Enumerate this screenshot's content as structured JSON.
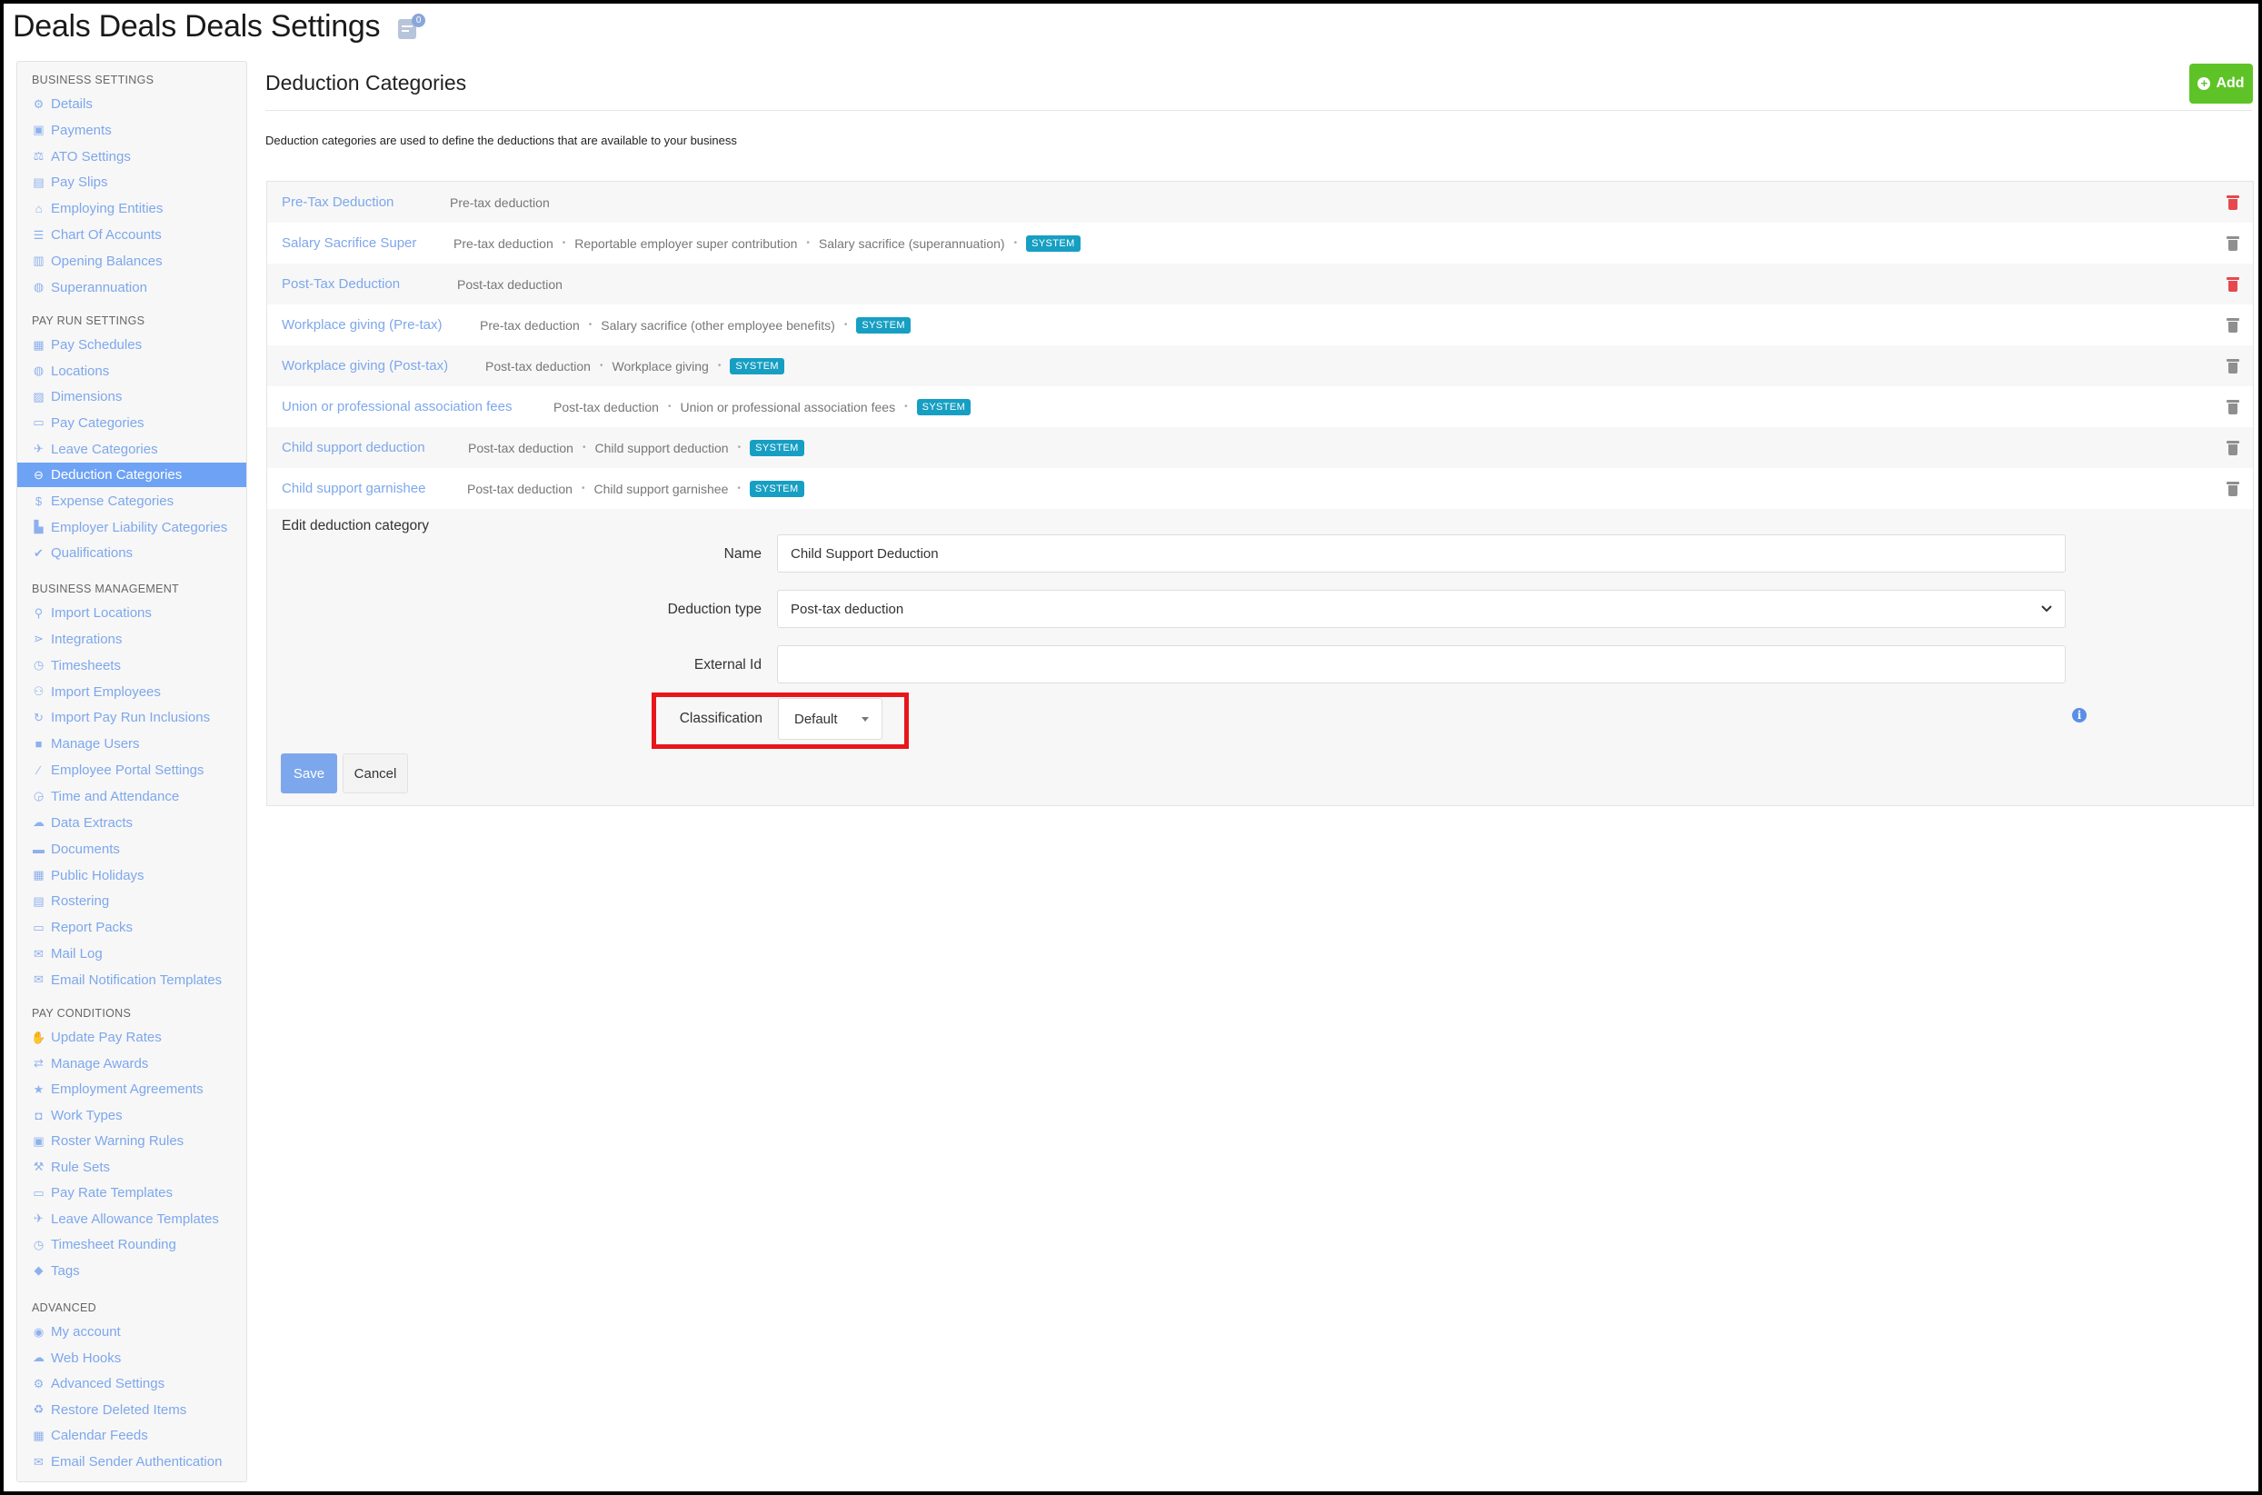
{
  "page": {
    "title": "Deals Deals Deals Settings",
    "notification_count": "0"
  },
  "sidebar": {
    "sections": [
      {
        "title": "BUSINESS SETTINGS",
        "items": [
          {
            "label": "Details",
            "icon": "gear-icon"
          },
          {
            "label": "Payments",
            "icon": "save-icon"
          },
          {
            "label": "ATO Settings",
            "icon": "scale-icon"
          },
          {
            "label": "Pay Slips",
            "icon": "file-icon"
          },
          {
            "label": "Employing Entities",
            "icon": "bank-icon"
          },
          {
            "label": "Chart Of Accounts",
            "icon": "list-icon"
          },
          {
            "label": "Opening Balances",
            "icon": "ledger-icon"
          },
          {
            "label": "Superannuation",
            "icon": "globe-icon"
          }
        ]
      },
      {
        "title": "PAY RUN SETTINGS",
        "items": [
          {
            "label": "Pay Schedules",
            "icon": "calendar-icon"
          },
          {
            "label": "Locations",
            "icon": "globe-icon"
          },
          {
            "label": "Dimensions",
            "icon": "bar-chart-icon"
          },
          {
            "label": "Pay Categories",
            "icon": "money-icon"
          },
          {
            "label": "Leave Categories",
            "icon": "plane-icon"
          },
          {
            "label": "Deduction Categories",
            "icon": "minus-circle-icon",
            "active": true
          },
          {
            "label": "Expense Categories",
            "icon": "dollar-icon"
          },
          {
            "label": "Employer Liability Categories",
            "icon": "factory-icon"
          },
          {
            "label": "Qualifications",
            "icon": "check-icon"
          }
        ]
      },
      {
        "title": "BUSINESS MANAGEMENT",
        "items": [
          {
            "label": "Import Locations",
            "icon": "map-pin-icon"
          },
          {
            "label": "Integrations",
            "icon": "plug-icon"
          },
          {
            "label": "Timesheets",
            "icon": "clock-icon"
          },
          {
            "label": "Import Employees",
            "icon": "people-icon"
          },
          {
            "label": "Import Pay Run Inclusions",
            "icon": "refresh-icon"
          },
          {
            "label": "Manage Users",
            "icon": "lock-icon"
          },
          {
            "label": "Employee Portal Settings",
            "icon": "wand-icon"
          },
          {
            "label": "Time and Attendance",
            "icon": "user-clock-icon"
          },
          {
            "label": "Data Extracts",
            "icon": "cloud-download-icon"
          },
          {
            "label": "Documents",
            "icon": "folder-icon"
          },
          {
            "label": "Public Holidays",
            "icon": "calendar-icon"
          },
          {
            "label": "Rostering",
            "icon": "schedule-icon"
          },
          {
            "label": "Report Packs",
            "icon": "folder-open-icon"
          },
          {
            "label": "Mail Log",
            "icon": "envelope-icon"
          },
          {
            "label": "Email Notification Templates",
            "icon": "envelope-open-icon"
          }
        ]
      },
      {
        "title": "PAY CONDITIONS",
        "items": [
          {
            "label": "Update Pay Rates",
            "icon": "hand-money-icon"
          },
          {
            "label": "Manage Awards",
            "icon": "exchange-icon"
          },
          {
            "label": "Employment Agreements",
            "icon": "star-icon"
          },
          {
            "label": "Work Types",
            "icon": "camera-icon"
          },
          {
            "label": "Roster Warning Rules",
            "icon": "warning-calendar-icon"
          },
          {
            "label": "Rule Sets",
            "icon": "gavel-icon"
          },
          {
            "label": "Pay Rate Templates",
            "icon": "money-icon"
          },
          {
            "label": "Leave Allowance Templates",
            "icon": "plane-icon"
          },
          {
            "label": "Timesheet Rounding",
            "icon": "clock-icon"
          },
          {
            "label": "Tags",
            "icon": "tag-icon"
          }
        ]
      },
      {
        "title": "ADVANCED",
        "items": [
          {
            "label": "My account",
            "icon": "user-circle-icon"
          },
          {
            "label": "Web Hooks",
            "icon": "cloud-icon"
          },
          {
            "label": "Advanced Settings",
            "icon": "gear-icon"
          },
          {
            "label": "Restore Deleted Items",
            "icon": "recycle-icon"
          },
          {
            "label": "Calendar Feeds",
            "icon": "calendar-icon"
          },
          {
            "label": "Email Sender Authentication",
            "icon": "envelope-icon"
          }
        ]
      }
    ]
  },
  "main": {
    "title": "Deduction Categories",
    "add_label": "Add",
    "description": "Deduction categories are used to define the deductions that are available to your business"
  },
  "categories": [
    {
      "name": "Pre-Tax Deduction",
      "tags": [
        "Pre-tax deduction"
      ],
      "system": false,
      "delete_color": "red"
    },
    {
      "name": "Salary Sacrifice Super",
      "tags": [
        "Pre-tax deduction",
        "Reportable employer super contribution",
        "Salary sacrifice (superannuation)"
      ],
      "system": true,
      "delete_color": "grey"
    },
    {
      "name": "Post-Tax Deduction",
      "tags": [
        "Post-tax deduction"
      ],
      "system": false,
      "delete_color": "red"
    },
    {
      "name": "Workplace giving (Pre-tax)",
      "tags": [
        "Pre-tax deduction",
        "Salary sacrifice (other employee benefits)"
      ],
      "system": true,
      "delete_color": "grey"
    },
    {
      "name": "Workplace giving (Post-tax)",
      "tags": [
        "Post-tax deduction",
        "Workplace giving"
      ],
      "system": true,
      "delete_color": "grey"
    },
    {
      "name": "Union or professional association fees",
      "tags": [
        "Post-tax deduction",
        "Union or professional association fees"
      ],
      "system": true,
      "delete_color": "grey"
    },
    {
      "name": "Child support deduction",
      "tags": [
        "Post-tax deduction",
        "Child support deduction"
      ],
      "system": true,
      "delete_color": "grey"
    },
    {
      "name": "Child support garnishee",
      "tags": [
        "Post-tax deduction",
        "Child support garnishee"
      ],
      "system": true,
      "delete_color": "grey"
    }
  ],
  "system_badge": "SYSTEM",
  "edit": {
    "heading": "Edit deduction category",
    "name_label": "Name",
    "name_value": "Child Support Deduction",
    "type_label": "Deduction type",
    "type_value": "Post-tax deduction",
    "external_id_label": "External Id",
    "external_id_value": "",
    "classification_label": "Classification",
    "classification_value": "Default",
    "save_label": "Save",
    "cancel_label": "Cancel"
  },
  "colors": {
    "accent": "#7da7ec",
    "active_item": "#6ea2f5",
    "add_button": "#5ec327",
    "system_badge": "#179fc3",
    "delete_red": "#e5484d",
    "highlight_box": "#e8161a"
  }
}
